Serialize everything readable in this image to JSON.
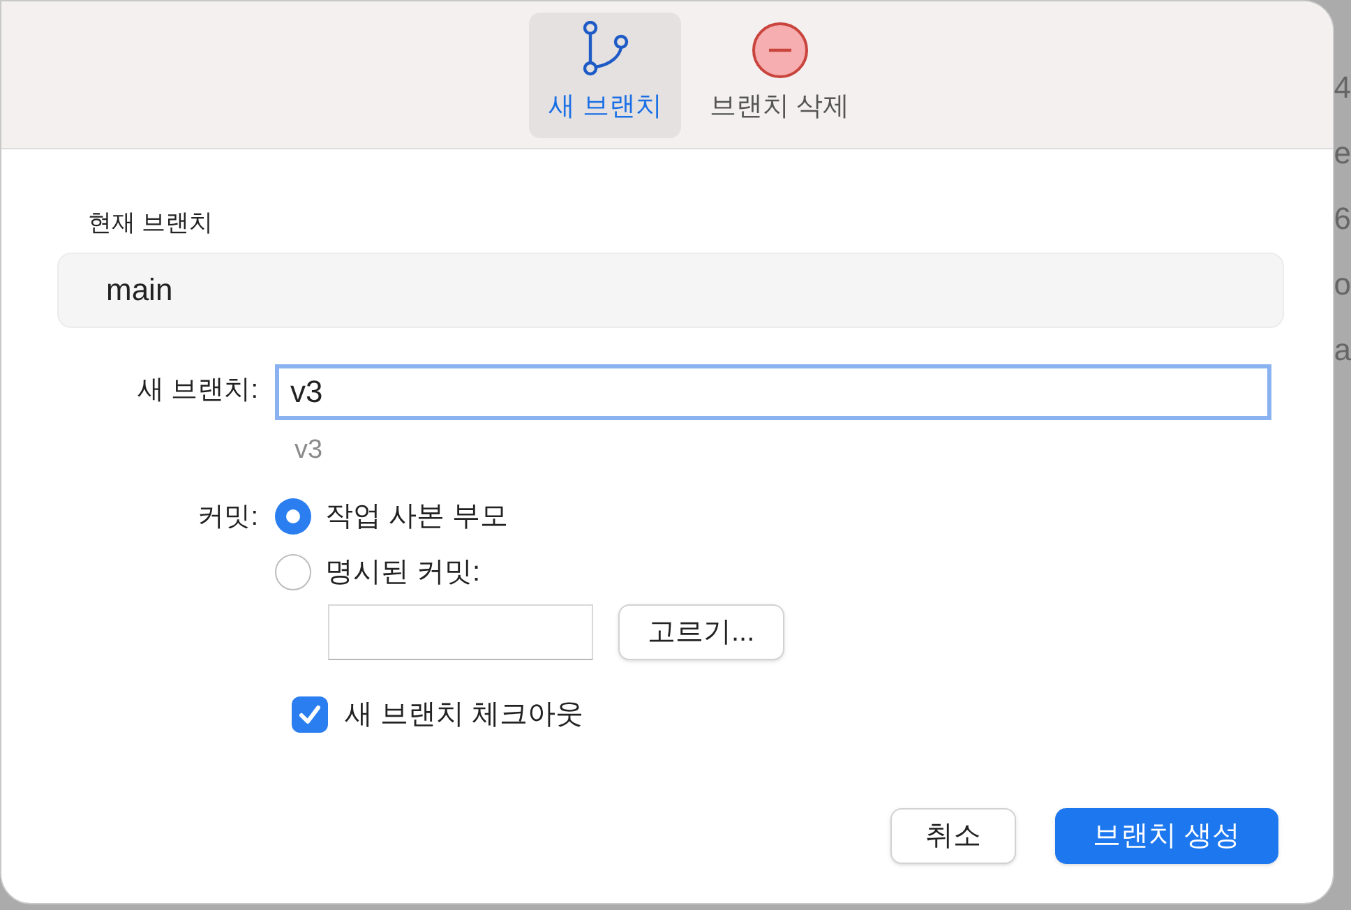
{
  "toolbar": {
    "items": [
      {
        "label": "새 브랜치",
        "kind": "branch",
        "selected": true
      },
      {
        "label": "브랜치 삭제",
        "kind": "delete",
        "selected": false
      }
    ]
  },
  "current_branch": {
    "label": "현재 브랜치",
    "value": "main"
  },
  "new_branch": {
    "label": "새 브랜치:",
    "value": "v3",
    "hint": "v3"
  },
  "commit": {
    "label": "커밋:",
    "options": [
      {
        "label": "작업 사본 부모",
        "selected": true
      },
      {
        "label": "명시된 커밋:",
        "selected": false
      }
    ],
    "choose_button": "고르기..."
  },
  "checkout": {
    "label": "새 브랜치 체크아웃",
    "checked": true
  },
  "buttons": {
    "cancel": "취소",
    "create": "브랜치 생성"
  },
  "background_fragments": [
    "4",
    "e",
    "6",
    "o",
    "a"
  ]
}
